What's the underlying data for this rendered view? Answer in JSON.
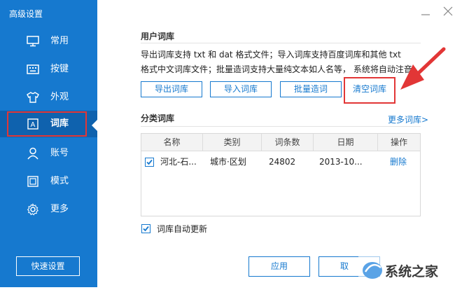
{
  "window": {
    "title": "高级设置"
  },
  "sidebar": {
    "items": [
      {
        "label": "常用",
        "icon": "monitor-icon"
      },
      {
        "label": "按键",
        "icon": "keyboard-icon"
      },
      {
        "label": "外观",
        "icon": "shirt-icon"
      },
      {
        "label": "词库",
        "icon": "letter-a-icon"
      },
      {
        "label": "账号",
        "icon": "user-icon"
      },
      {
        "label": "模式",
        "icon": "window-icon"
      },
      {
        "label": "更多",
        "icon": "gear-icon"
      }
    ],
    "active_index": 3,
    "quick_settings": "快速设置"
  },
  "user_lexicon": {
    "title": "用户词库",
    "desc_line1": "导出词库支持 txt 和 dat 格式文件；导入词库支持百度词库和其他 txt",
    "desc_line2": "格式中文词库文件；批量造词支持大量纯文本如人名等， 系统将自动注音。",
    "buttons": {
      "export": "导出词库",
      "import": "导入词库",
      "batch": "批量造词",
      "clear": "清空词库"
    }
  },
  "category_lexicon": {
    "title": "分类词库",
    "more": "更多词库>",
    "columns": [
      "名称",
      "类别",
      "词条数",
      "日期",
      "操作"
    ],
    "rows": [
      {
        "name": "河北-石...",
        "category": "城市·区划",
        "count": "24802",
        "date": "2013-10...",
        "action": "删除",
        "checked": true
      }
    ]
  },
  "auto_update": {
    "label": "词库自动更新",
    "checked": true
  },
  "footer": {
    "apply": "应用",
    "cancel": "取"
  },
  "watermark": {
    "text": "系统之家"
  },
  "colors": {
    "accent": "#1679cf",
    "highlight": "#e23636"
  }
}
